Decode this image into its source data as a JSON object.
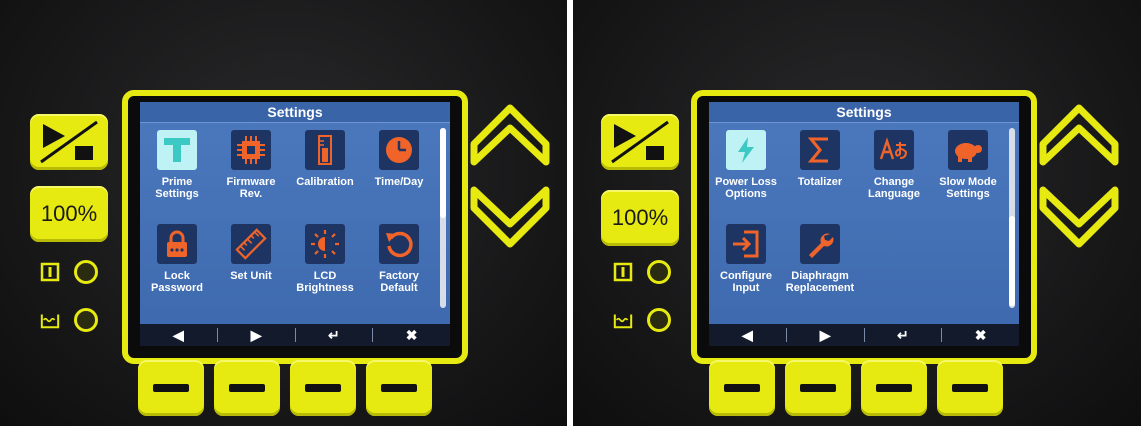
{
  "panels": [
    {
      "title": "Settings",
      "hundred_label": "100%",
      "items": [
        {
          "label": "Prime\nSettings",
          "icon": "prime-icon",
          "selected": true
        },
        {
          "label": "Firmware\nRev.",
          "icon": "chip-icon",
          "selected": false
        },
        {
          "label": "Calibration",
          "icon": "calibration-icon",
          "selected": false
        },
        {
          "label": "Time/Day",
          "icon": "clock-icon",
          "selected": false
        },
        {
          "label": "Lock\nPassword",
          "icon": "lock-icon",
          "selected": false
        },
        {
          "label": "Set Unit",
          "icon": "ruler-icon",
          "selected": false
        },
        {
          "label": "LCD\nBrightness",
          "icon": "brightness-icon",
          "selected": false
        },
        {
          "label": "Factory\nDefault",
          "icon": "reset-icon",
          "selected": false
        }
      ],
      "softkeys": [
        "◀",
        "▶",
        "↵",
        "✖"
      ]
    },
    {
      "title": "Settings",
      "hundred_label": "100%",
      "items": [
        {
          "label": "Power Loss\nOptions",
          "icon": "power-loss-icon",
          "selected": true
        },
        {
          "label": "Totalizer",
          "icon": "sigma-icon",
          "selected": false
        },
        {
          "label": "Change\nLanguage",
          "icon": "language-icon",
          "selected": false
        },
        {
          "label": "Slow Mode\nSettings",
          "icon": "turtle-icon",
          "selected": false
        },
        {
          "label": "Configure\nInput",
          "icon": "input-icon",
          "selected": false
        },
        {
          "label": "Diaphragm\nReplacement",
          "icon": "wrench-icon",
          "selected": false
        }
      ],
      "softkeys": [
        "◀",
        "▶",
        "↵",
        "✖"
      ]
    }
  ],
  "colors": {
    "accent_yellow": "#e7ea10",
    "screen_blue": "#4c79be",
    "icon_orange": "#f0642a",
    "icon_bg": "#1e3563",
    "selected_bg": "#bff2f4"
  }
}
